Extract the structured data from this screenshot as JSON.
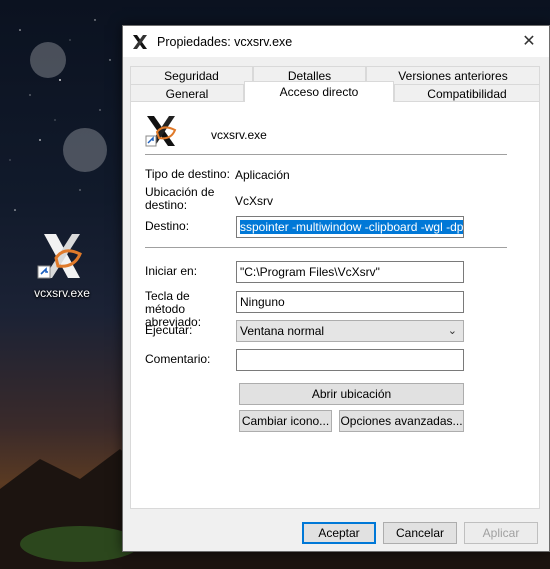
{
  "desktop": {
    "icon_label": "vcxsrv.exe",
    "icon_name": "vcxsrv-x-icon"
  },
  "dialog": {
    "title": "Propiedades: vcxsrv.exe",
    "close_symbol": "✕",
    "tabs_row1": [
      "Seguridad",
      "Detalles",
      "Versiones anteriores"
    ],
    "tabs_row2": [
      "General",
      "Acceso directo",
      "Compatibilidad"
    ],
    "active_tab": "Acceso directo",
    "file_name": "vcxsrv.exe",
    "target_type_label": "Tipo de destino:",
    "target_type_value": "Aplicación",
    "location_label": "Ubicación de destino:",
    "location_value": "VcXsrv",
    "target_label": "Destino:",
    "target_value": "sspointer -multiwindow -clipboard -wgl -dpi auto",
    "start_in_label": "Iniciar en:",
    "start_in_value": "\"C:\\Program Files\\VcXsrv\"",
    "shortcut_key_label": "Tecla de método abreviado:",
    "shortcut_key_value": "Ninguno",
    "run_label": "Ejecutar:",
    "run_value": "Ventana normal",
    "comment_label": "Comentario:",
    "comment_value": "",
    "open_location_button": "Abrir ubicación",
    "change_icon_button": "Cambiar icono...",
    "advanced_button": "Opciones avanzadas...",
    "ok_button": "Aceptar",
    "cancel_button": "Cancelar",
    "apply_button": "Aplicar"
  },
  "colors": {
    "selection": "#0078d7",
    "dialog_bg": "#f0f0f0"
  }
}
